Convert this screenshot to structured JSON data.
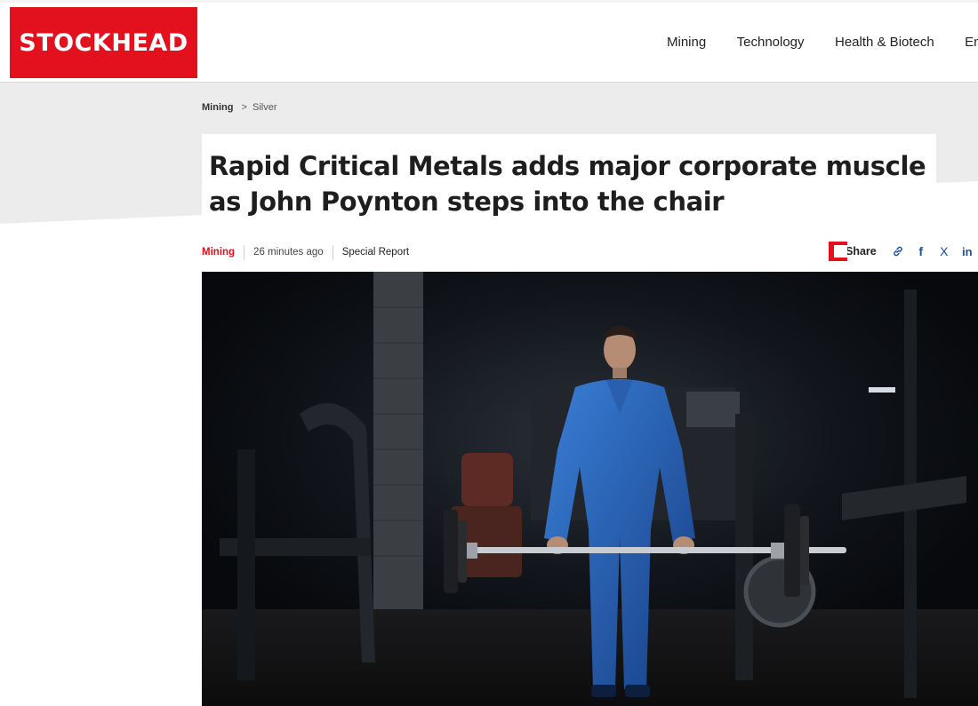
{
  "brand": {
    "logo_text": "STOCKHEAD",
    "color": "#e3101e"
  },
  "nav": {
    "items": [
      {
        "label": "Mining"
      },
      {
        "label": "Technology"
      },
      {
        "label": "Health & Biotech"
      },
      {
        "label": "Ene"
      }
    ]
  },
  "breadcrumb": {
    "section": "Mining",
    "separator": ">",
    "subsection": "Silver"
  },
  "article": {
    "title": "Rapid Critical Metals adds major corporate muscle as John Poynton steps into the chair",
    "category": "Mining",
    "time_ago": "26 minutes ago",
    "report_type": "Special Report"
  },
  "share": {
    "label": "Share",
    "icons": [
      "link-icon",
      "facebook-icon",
      "x-icon",
      "linkedin-icon"
    ],
    "facebook_glyph": "f",
    "x_glyph": "X",
    "linkedin_glyph": "in"
  },
  "hero_image": {
    "description_icon": "businessman-barbell-gym-photo"
  },
  "colors": {
    "accent": "#e3101e",
    "band": "#ececec",
    "social": "#1a4fa0"
  }
}
